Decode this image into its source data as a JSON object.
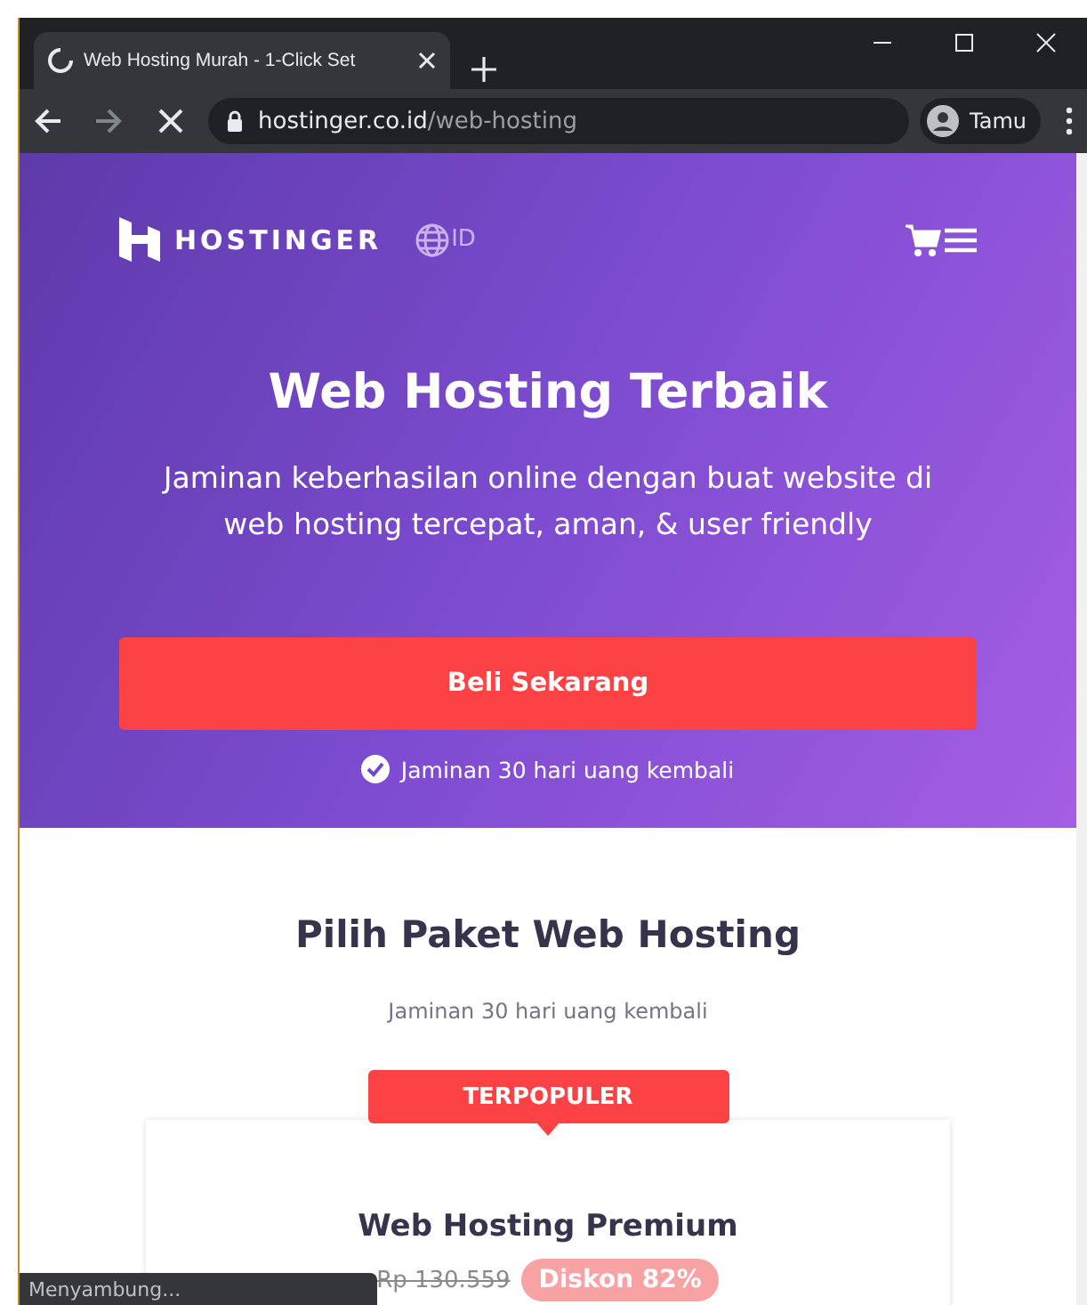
{
  "browser": {
    "tab": {
      "title": "Web Hosting Murah - 1-Click Set",
      "selected": true
    },
    "address": {
      "domain": "hostinger.co.id",
      "path": "/web-hosting"
    },
    "profile": "Tamu"
  },
  "nav": {
    "brand": "HOSTINGER",
    "language": "ID"
  },
  "hero": {
    "title": "Web Hosting Terbaik",
    "subtitle": "Jaminan keberhasilan online dengan buat website di web hosting tercepat, aman, & user friendly",
    "button": "Beli Sekarang",
    "guarantee": "Jaminan 30 hari uang kembali"
  },
  "plans": {
    "title": "Pilih Paket Web Hosting",
    "subtitle": "Jaminan 30 hari uang kembali",
    "badge": "TERPOPULER",
    "card": {
      "name": "Web Hosting Premium",
      "old_price": "Rp 130.559",
      "discount": "Diskon 82%"
    }
  },
  "status_bar": "Menyambung..."
}
